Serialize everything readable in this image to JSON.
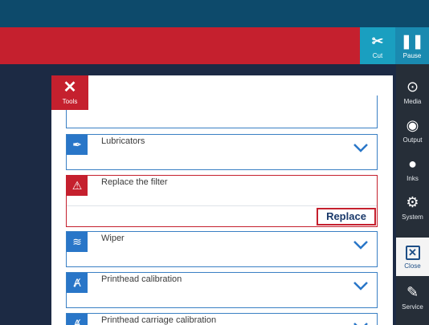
{
  "toolbar": {
    "cut_label": "Cut",
    "pause_label": "Pause"
  },
  "panel": {
    "tab_label": "Tools"
  },
  "items": [
    {
      "title": "Lubricators",
      "icon": "lubricator-icon"
    },
    {
      "title": "Replace the filter",
      "icon": "warning-icon",
      "action": "Replace"
    },
    {
      "title": "Wiper",
      "icon": "wiper-icon"
    },
    {
      "title": "Printhead calibration",
      "icon": "calibration-icon"
    },
    {
      "title": "Printhead carriage calibration",
      "icon": "calibration-icon"
    }
  ],
  "sidebar": {
    "items": [
      {
        "label": "Media",
        "icon": "media-icon"
      },
      {
        "label": "Output",
        "icon": "output-icon"
      },
      {
        "label": "Inks",
        "icon": "ink-drop-icon"
      },
      {
        "label": "System",
        "icon": "gear-icon"
      },
      {
        "label": "Close",
        "icon": "close-icon"
      },
      {
        "label": "Service",
        "icon": "service-icon"
      }
    ]
  },
  "colors": {
    "header_blue": "#0d4a6b",
    "alert_red": "#c5202e",
    "item_blue": "#2976c8",
    "sidebar": "#262e38",
    "background": "#1c2a44"
  }
}
